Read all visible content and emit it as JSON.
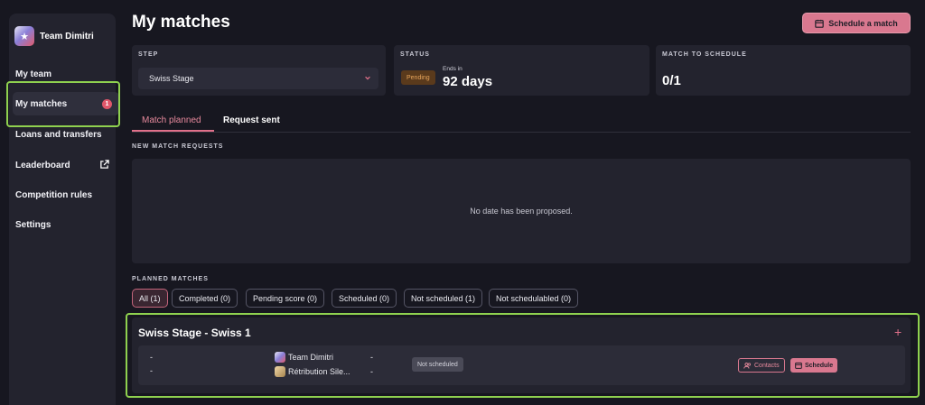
{
  "sidebar": {
    "team_name": "Team Dimitri",
    "items": [
      {
        "label": "My team"
      },
      {
        "label": "My matches",
        "badge": "1"
      },
      {
        "label": "Loans and transfers"
      },
      {
        "label": "Leaderboard"
      },
      {
        "label": "Competition rules"
      },
      {
        "label": "Settings"
      }
    ]
  },
  "header": {
    "title": "My matches",
    "schedule_button": "Schedule a match"
  },
  "cards": {
    "step": {
      "label": "STEP",
      "value": "Swiss Stage"
    },
    "status": {
      "label": "STATUS",
      "pill": "Pending",
      "ends_in": "Ends in",
      "days": "92 days"
    },
    "to_schedule": {
      "label": "MATCH TO SCHEDULE",
      "value": "0/1"
    }
  },
  "tabs": [
    {
      "label": "Match planned"
    },
    {
      "label": "Request sent"
    }
  ],
  "requests": {
    "label": "NEW MATCH REQUESTS",
    "empty_text": "No date has been proposed."
  },
  "planned": {
    "label": "PLANNED MATCHES",
    "filters": [
      {
        "label": "All (1)"
      },
      {
        "label": "Completed (0)"
      },
      {
        "label": "Pending score (0)"
      },
      {
        "label": "Scheduled (0)"
      },
      {
        "label": "Not scheduled (1)"
      },
      {
        "label": "Not schedulabled (0)"
      }
    ],
    "group_title": "Swiss Stage - Swiss 1",
    "match": {
      "date_line1": "-",
      "date_line2": "-",
      "team1": "Team Dimitri",
      "team2": "Rétribution Sile...",
      "score1": "-",
      "score2": "-",
      "status": "Not scheduled",
      "contacts": "Contacts",
      "schedule": "Schedule"
    }
  },
  "colors": {
    "accent": "#d9788f",
    "highlight": "#8fd14f",
    "pending": "#e7a45b"
  }
}
